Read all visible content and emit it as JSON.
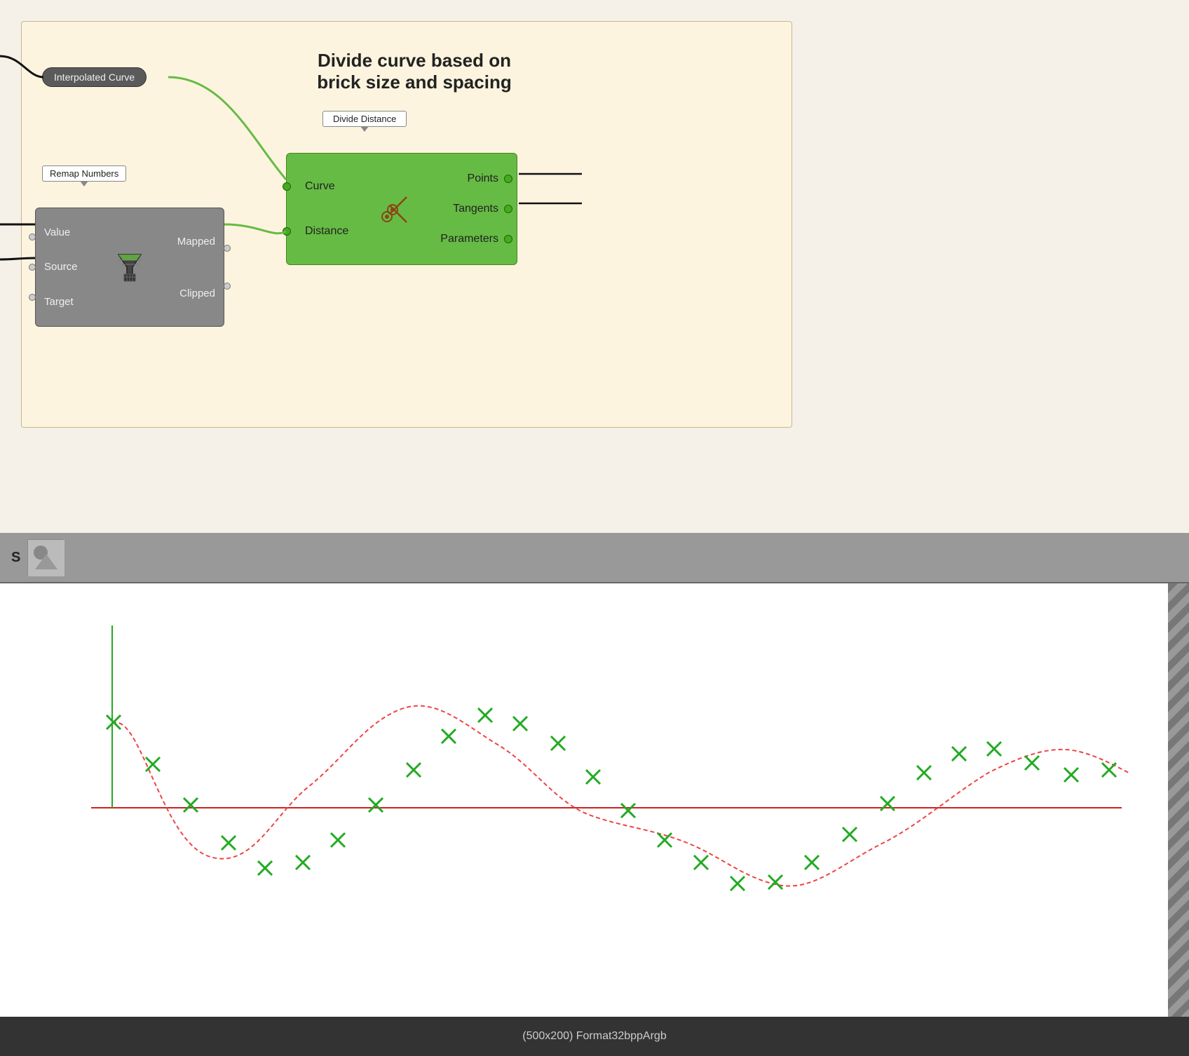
{
  "canvas": {
    "background": "#f5f0e8"
  },
  "group_box": {
    "title_line1": "Divide curve based on",
    "title_line2": "brick size and spacing"
  },
  "interp_curve_node": {
    "label": "Interpolated Curve"
  },
  "remap_tooltip": {
    "label": "Remap Numbers"
  },
  "remap_node": {
    "input_labels": [
      "Value",
      "Source",
      "Target"
    ],
    "output_labels": [
      "Mapped",
      "Clipped"
    ],
    "icon": "🎚"
  },
  "divide_tooltip": {
    "label": "Divide Distance"
  },
  "divide_node": {
    "input_labels": [
      "Curve",
      "Distance"
    ],
    "output_labels": [
      "Points",
      "Tangents",
      "Parameters"
    ],
    "icon": "✂"
  },
  "preview": {
    "s_label": "S",
    "footer_text": "(500x200) Format32bppArgb"
  }
}
